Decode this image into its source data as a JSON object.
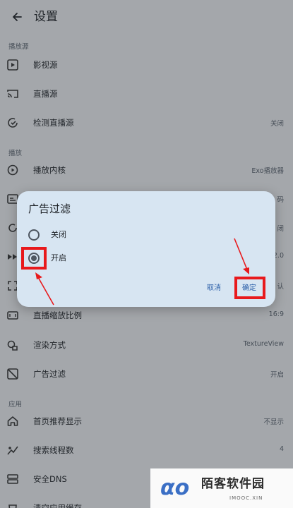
{
  "header": {
    "title": "设置"
  },
  "sections": {
    "playback_source": "播放源",
    "playback": "播放",
    "app": "应用"
  },
  "rows": {
    "video_source": {
      "label": "影视源",
      "value": ""
    },
    "live_source": {
      "label": "直播源",
      "value": ""
    },
    "detect_live": {
      "label": "检测直播源",
      "value": "关闭"
    },
    "player_core": {
      "label": "播放内核",
      "value": "Exo播放器"
    },
    "decode": {
      "label": "",
      "value": "码"
    },
    "row_loop": {
      "label": "",
      "value": "闭"
    },
    "row_speed": {
      "label": "",
      "value": "2.0"
    },
    "row_scale": {
      "label": "",
      "value": "认"
    },
    "live_scale": {
      "label": "直播缩放比例",
      "value": "16:9"
    },
    "render": {
      "label": "渲染方式",
      "value": "TextureView"
    },
    "ad_filter": {
      "label": "广告过滤",
      "value": "开启"
    },
    "home_recommend": {
      "label": "首页推荐显示",
      "value": "不显示"
    },
    "search_threads": {
      "label": "搜索线程数",
      "value": "4"
    },
    "secure_dns": {
      "label": "安全DNS",
      "value": ""
    },
    "clear_cache": {
      "label": "清空应用缓存",
      "value": ""
    }
  },
  "dialog": {
    "title": "广告过滤",
    "options": [
      {
        "label": "关闭",
        "checked": false
      },
      {
        "label": "开启",
        "checked": true
      }
    ],
    "cancel": "取消",
    "confirm": "确定"
  },
  "watermark": {
    "title": "陌客软件园",
    "subtitle": "IMOOC.XIN"
  },
  "colors": {
    "highlight": "#e8191c",
    "accent": "#2a5ea8",
    "dialog_bg": "#d7e5f2"
  },
  "icons": {
    "back": "arrow-back-icon",
    "video_source": "play-box-icon",
    "live_source": "cast-icon",
    "detect_live": "check-refresh-icon",
    "player_core": "play-circle-icon",
    "live_scale": "aspect-ratio-icon",
    "render": "render-icon",
    "ad_filter": "ad-block-icon",
    "home_recommend": "home-icon",
    "search_threads": "threads-icon",
    "secure_dns": "dns-icon"
  }
}
